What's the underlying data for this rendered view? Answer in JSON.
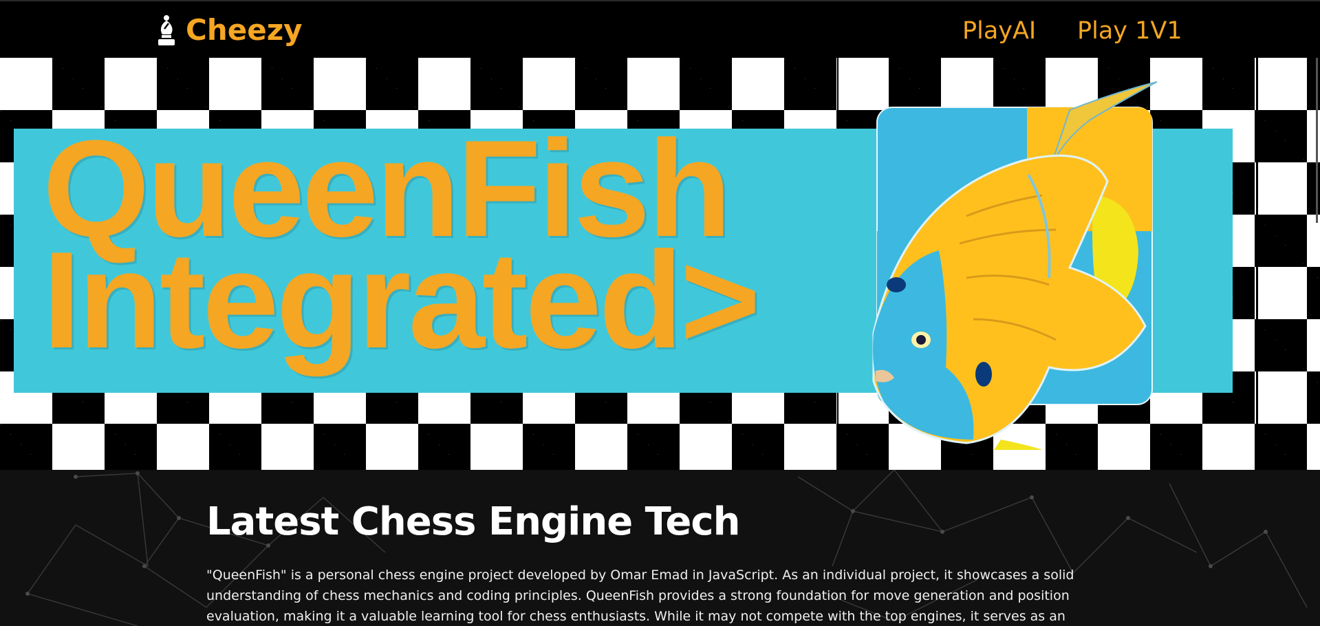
{
  "nav": {
    "brand_icon": "chess-bishop-icon",
    "brand_name": "Cheezy",
    "links": [
      {
        "label": "PlayAI"
      },
      {
        "label": "Play 1V1"
      }
    ]
  },
  "hero": {
    "headline_line1": "QueenFish",
    "headline_line2": "Integrated>",
    "image": "queen-angelfish-illustration"
  },
  "section": {
    "title": "Latest Chess Engine Tech",
    "body": "\"QueenFish\" is a personal chess engine project developed by Omar Emad in JavaScript. As an individual project, it showcases a solid understanding of chess mechanics and coding principles. QueenFish provides a strong foundation for move generation and position evaluation, making it a valuable learning tool for chess enthusiasts. While it may not compete with the top engines, it serves as an excellent project that demonstrates Omar's"
  },
  "colors": {
    "accent": "#f5a623",
    "banner": "#40c8da",
    "page_bg": "#000000",
    "section_bg": "#111111",
    "fish_yellow": "#ffc01e",
    "fish_blue": "#3db8e0"
  }
}
